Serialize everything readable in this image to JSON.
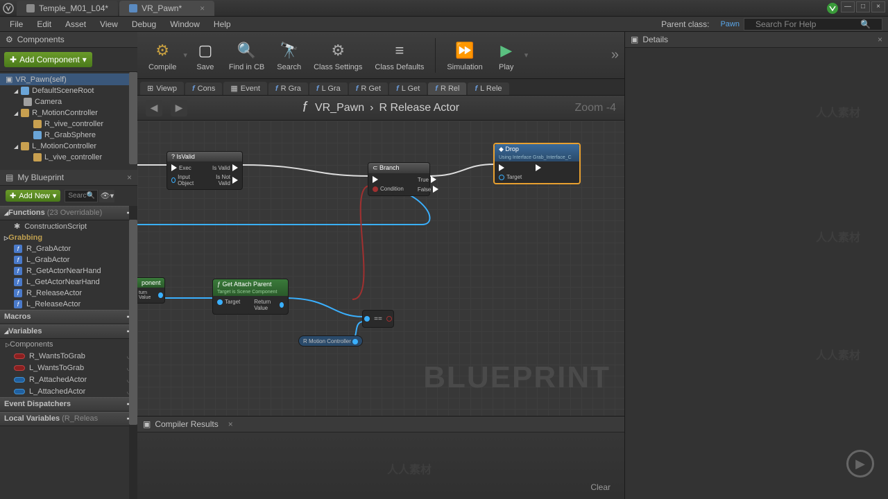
{
  "tabs": [
    {
      "label": "Temple_M01_L04*"
    },
    {
      "label": "VR_Pawn*"
    }
  ],
  "menu": [
    "File",
    "Edit",
    "Asset",
    "View",
    "Debug",
    "Window",
    "Help"
  ],
  "parent_class": {
    "label": "Parent class:",
    "value": "Pawn"
  },
  "search_placeholder": "Search For Help",
  "components": {
    "title": "Components",
    "add": "Add Component",
    "tree": [
      {
        "label": "VR_Pawn(self)",
        "ind": 0,
        "ico": "comp",
        "tri": "▼"
      },
      {
        "label": "DefaultSceneRoot",
        "ind": 1,
        "ico": "comp",
        "tri": "▲"
      },
      {
        "label": "Camera",
        "ind": 2,
        "ico": "cam"
      },
      {
        "label": "R_MotionController",
        "ind": 1,
        "ico": "ctrl",
        "tri": "▲"
      },
      {
        "label": "R_vive_controller",
        "ind": 2,
        "ico": "ctrl"
      },
      {
        "label": "R_GrabSphere",
        "ind": 2,
        "ico": "comp"
      },
      {
        "label": "L_MotionController",
        "ind": 1,
        "ico": "ctrl",
        "tri": "▲"
      },
      {
        "label": "L_vive_controller",
        "ind": 2,
        "ico": "ctrl"
      }
    ]
  },
  "myblueprint": {
    "title": "My Blueprint",
    "add": "Add New",
    "search_ph": "Searc",
    "functions": {
      "title": "Functions",
      "sub": "(23 Overridable)",
      "items": [
        "ConstructionScript"
      ]
    },
    "grabbing": {
      "title": "Grabbing",
      "items": [
        "R_GrabActor",
        "L_GrabActor",
        "R_GetActorNearHand",
        "L_GetActorNearHand",
        "R_ReleaseActor",
        "L_ReleaseActor"
      ]
    },
    "macros": "Macros",
    "variables": {
      "title": "Variables",
      "sub": "Components",
      "items": [
        {
          "name": "R_WantsToGrab",
          "c": "red"
        },
        {
          "name": "L_WantsToGrab",
          "c": "red"
        },
        {
          "name": "R_AttachedActor",
          "c": "blue"
        },
        {
          "name": "L_AttachedActor",
          "c": "blue"
        }
      ]
    },
    "dispatchers": "Event Dispatchers",
    "localvars": {
      "title": "Local Variables",
      "sub": "(R_Releas"
    }
  },
  "toolbar": [
    {
      "label": "Compile",
      "ico": "⚙",
      "cls": "gear"
    },
    {
      "label": "Save",
      "ico": "💾",
      "cls": "disk"
    },
    {
      "label": "Find in CB",
      "ico": "🔍",
      "cls": "mag"
    },
    {
      "label": "Search",
      "ico": "🔎",
      "cls": "mag"
    },
    {
      "label": "Class Settings",
      "ico": "⚙",
      "cls": "gear"
    },
    {
      "label": "Class Defaults",
      "ico": "≡",
      "cls": "mag"
    },
    {
      "label": "Simulation",
      "ico": "▶",
      "cls": "simico"
    },
    {
      "label": "Play",
      "ico": "▶",
      "cls": "playico"
    }
  ],
  "graphtabs": [
    {
      "label": "Viewp",
      "f": false,
      "ico": "⊞"
    },
    {
      "label": "Cons",
      "f": true
    },
    {
      "label": "Event",
      "f": false,
      "ico": "▦"
    },
    {
      "label": "R Gra",
      "f": true
    },
    {
      "label": "L Gra",
      "f": true
    },
    {
      "label": "R Get",
      "f": true
    },
    {
      "label": "L Get",
      "f": true
    },
    {
      "label": "R Rel",
      "f": true,
      "active": true
    },
    {
      "label": "L Rele",
      "f": true
    }
  ],
  "breadcrumb": {
    "a": "VR_Pawn",
    "b": "R Release Actor"
  },
  "zoom": "Zoom -4",
  "nodes": {
    "isvalid": {
      "title": "? IsValid",
      "pins_l": [
        "Exec",
        "Input Object"
      ],
      "pins_r": [
        "Is Valid",
        "Is Not Valid"
      ]
    },
    "branch": {
      "title": "⊂ Branch",
      "pins_l": [
        "",
        "Condition"
      ],
      "pins_r": [
        "True",
        "False"
      ]
    },
    "drop": {
      "title": "◆ Drop",
      "sub": "Using Interface Grab_Interface_C",
      "pins_l": [
        "",
        "Target"
      ]
    },
    "getattach": {
      "title": "ƒ Get Attach Parent",
      "sub": "Target is Scene Component",
      "pins_l": [
        "Target"
      ],
      "pins_r": [
        "Return Value"
      ]
    },
    "frag_left": {
      "t": "ponent",
      "b": "turn Value"
    },
    "rmotion": "R Motion Controller"
  },
  "watermark": "BLUEPRINT",
  "compiler": {
    "title": "Compiler Results",
    "clear": "Clear"
  },
  "details": "Details"
}
